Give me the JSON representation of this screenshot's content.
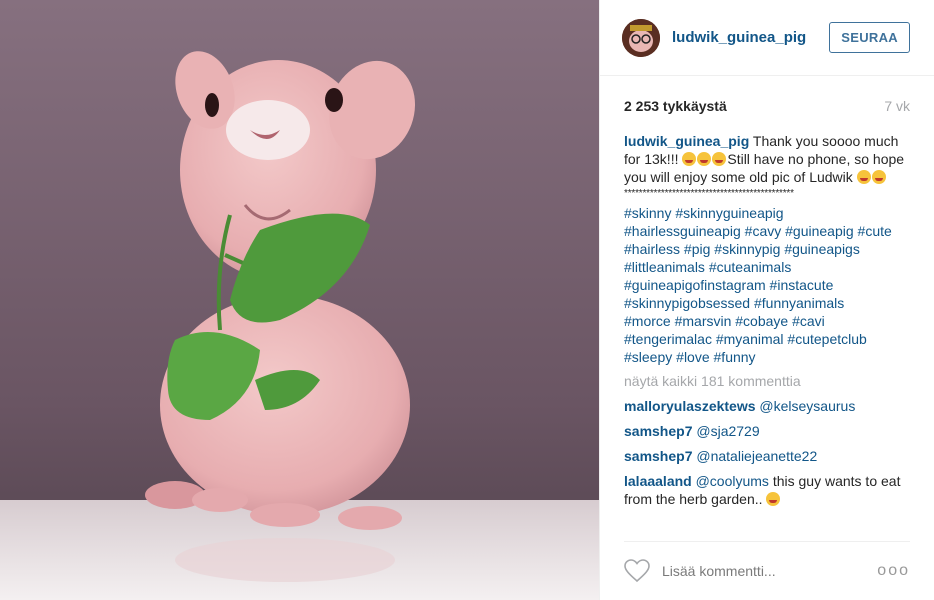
{
  "photo": {
    "description_icon": "guinea-pig-photo"
  },
  "header": {
    "username": "ludwik_guinea_pig",
    "follow_label": "SEURAA"
  },
  "stats": {
    "likes": "2 253 tykkäystä",
    "age": "7 vk"
  },
  "caption": {
    "username": "ludwik_guinea_pig",
    "text_1": "Thank you soooo much for 13k!!! ",
    "text_2": "Still have no phone, so hope you will enjoy some old pic of Ludwik ",
    "divider": "**********************************************",
    "hashtags": [
      "#skinny",
      "#skinnyguineapig",
      "#hairlessguineapig",
      "#cavy",
      "#guineapig",
      "#cute",
      "#hairless",
      "#pig",
      "#skinnypig",
      "#guineapigs",
      "#littleanimals",
      "#cuteanimals",
      "#guineapigofinstagram",
      "#instacute",
      "#skinnypigobsessed",
      "#funnyanimals",
      "#morce",
      "#marsvin",
      "#cobaye",
      "#cavi",
      "#tengerimalac",
      "#myanimal",
      "#cutepetclub",
      "#sleepy",
      "#love",
      "#funny"
    ]
  },
  "view_all": "näytä kaikki 181 kommenttia",
  "comments": [
    {
      "user": "malloryulaszektews",
      "text": "@kelseysaurus"
    },
    {
      "user": "samshep7",
      "text": "@sja2729"
    },
    {
      "user": "samshep7",
      "text": "@nataliejeanette22"
    },
    {
      "user": "lalaaaland",
      "mention": "@coolyums",
      "text": " this guy wants to eat from the herb garden.. "
    }
  ],
  "footer": {
    "like_icon": "heart-outline-icon",
    "add_comment": "Lisää kommentti...",
    "more_icon": "ellipsis-icon",
    "more_label": "ooo"
  },
  "colors": {
    "link": "#125688",
    "follow": "#3f729b",
    "muted": "#a5a7aa"
  }
}
